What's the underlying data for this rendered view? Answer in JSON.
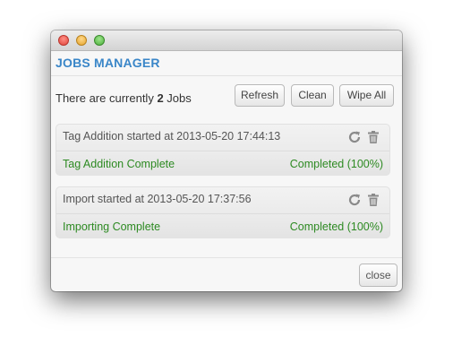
{
  "header": {
    "title": "JOBS MANAGER"
  },
  "summary": {
    "prefix": "There are currently ",
    "count": "2",
    "suffix": " Jobs"
  },
  "toolbar": {
    "refresh_label": "Refresh",
    "clean_label": "Clean",
    "wipe_all_label": "Wipe All"
  },
  "jobs": [
    {
      "title": "Tag Addition started at 2013-05-20 17:44:13",
      "status": "Tag Addition Complete",
      "progress_text": "Completed (100%)",
      "progress": 1.0
    },
    {
      "title": "Import started at 2013-05-20 17:37:56",
      "status": "Importing Complete",
      "progress_text": "Completed (100%)",
      "progress": 1.0
    }
  ],
  "footer": {
    "close_label": "close"
  },
  "icons": {
    "refresh": "refresh-icon",
    "delete": "trash-icon"
  },
  "colors": {
    "accent": "#3a86c8",
    "success": "#2d8a22"
  }
}
